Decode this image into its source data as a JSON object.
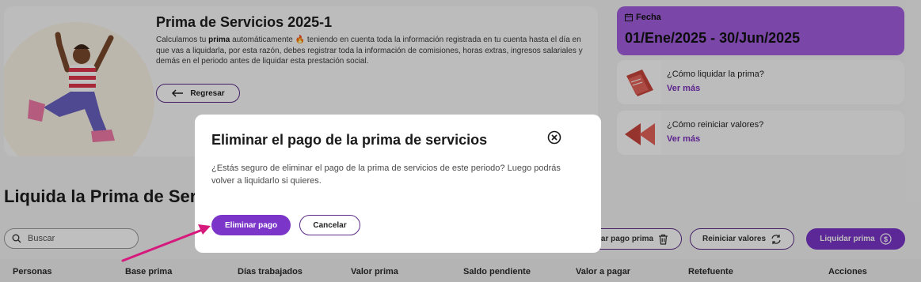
{
  "hero": {
    "title": "Prima de Servicios 2025-1",
    "desc_pre": "Calculamos tu ",
    "desc_bold": "prima",
    "desc_post": " automáticamente 🔥 teniendo en cuenta toda la información registrada en tu cuenta hasta el día en que vas a liquidarla, por esta razón, debes registrar toda la información de comisiones, horas extras, ingresos salariales y demás en el periodo antes de liquidar esta prestación social.",
    "back_label": "Regresar"
  },
  "fecha": {
    "label": "Fecha",
    "value": "01/Ene/2025 - 30/Jun/2025",
    "icon": "calendar-icon"
  },
  "info_cards": [
    {
      "question": "¿Cómo liquidar la prima?",
      "link": "Ver más"
    },
    {
      "question": "¿Cómo reiniciar valores?",
      "link": "Ver más"
    }
  ],
  "section_title": "Liquida la Prima de Servicios",
  "search": {
    "placeholder": "Buscar"
  },
  "toolbar": {
    "delete_label": "Eliminar pago prima",
    "reset_label": "Reiniciar valores",
    "liquidar_label": "Liquidar prima"
  },
  "table": {
    "columns": [
      "Personas",
      "Base prima",
      "Días trabajados",
      "Valor prima",
      "Saldo pendiente",
      "Valor a pagar",
      "Retefuente",
      "Acciones"
    ]
  },
  "modal": {
    "title": "Eliminar el pago de la prima de servicios",
    "text": "¿Estás seguro de eliminar el pago de la prima de servicios de este periodo? Luego podrás volver a liquidarlo si quieres.",
    "confirm_label": "Eliminar pago",
    "cancel_label": "Cancelar"
  },
  "colors": {
    "accent": "#7b35c8",
    "fecha_bg": "#a35fe0",
    "link": "#7b2fbe",
    "arrow": "#d6197c"
  }
}
